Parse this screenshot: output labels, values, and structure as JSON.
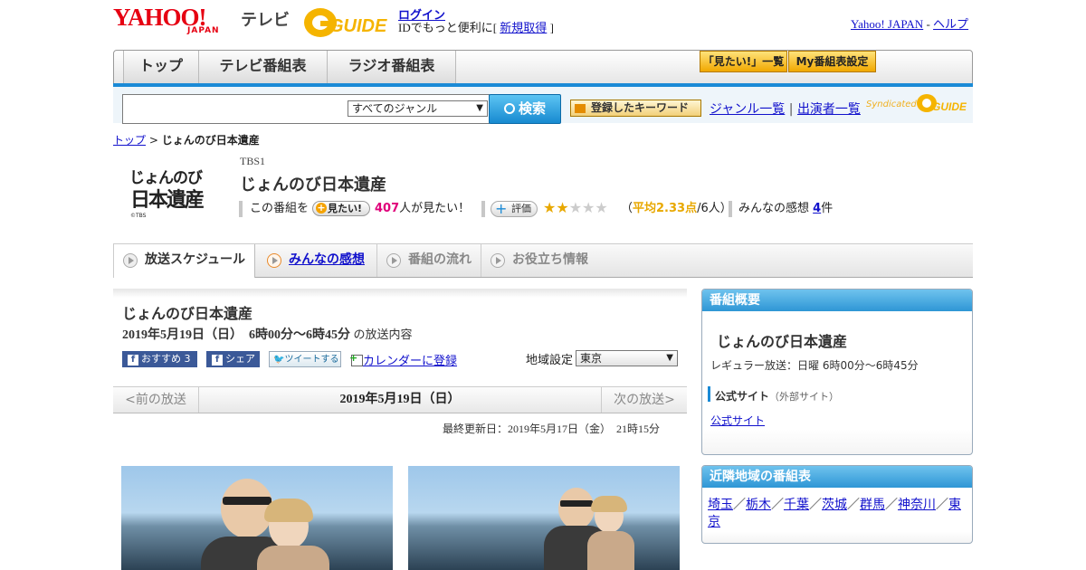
{
  "header": {
    "logo_text": "YAHOO!",
    "logo_sub": "JAPAN",
    "service": "テレビ",
    "gguide_text": "GUIDE",
    "login": "ログイン",
    "id_prefix": "IDでもっと便利に[",
    "signup": "新規取得",
    "id_suffix": "]",
    "yahoo_japan": "Yahoo! JAPAN",
    "sep": "-",
    "help": "ヘルプ"
  },
  "nav": {
    "tabs": [
      "トップ",
      "テレビ番組表",
      "ラジオ番組表"
    ],
    "mitai_list": "「見たい!」一覧",
    "my_settings": "My番組表設定"
  },
  "search": {
    "genre_selected": "すべてのジャンル",
    "button": "検索",
    "keyword_button": "登録したキーワード",
    "genre_list": "ジャンル一覧",
    "divider": "|",
    "performers": "出演者一覧",
    "syndicated": "Syndicated"
  },
  "breadcrumb": {
    "top": "トップ",
    "sep": ">",
    "current": "じょんのび日本遺産"
  },
  "program": {
    "logo_line1": "じょんのび",
    "logo_line2": "日本遺産",
    "logo_small": "©TBS",
    "channel": "TBS1",
    "title": "じょんのび日本遺産",
    "mitai_prefix": "この番組を",
    "mitai_button": "見たい!",
    "mitai_count": "407",
    "mitai_suffix": "人が見たい！",
    "rate_button": "評価",
    "stars": "★★★★★",
    "rating_filled": 2,
    "avg_open": "（",
    "avg_label": "平均2.33点",
    "avg_count": "/6人）",
    "impressions_label": "みんなの感想",
    "impressions_count": "4",
    "impressions_unit": "件"
  },
  "tabs2": [
    "放送スケジュール",
    "みんなの感想",
    "番組の流れ",
    "お役立ち情報"
  ],
  "panel": {
    "title": "じょんのび日本遺産",
    "date_time": "2019年5月19日（日）　6時00分～6時45分",
    "date_suffix": "の放送内容",
    "recommend": "おすすめ",
    "recommend_count": "3",
    "share": "シェア",
    "tweet": "ツイートする",
    "calendar": "カレンダーに登録",
    "region_label": "地域設定",
    "region_value": "東京",
    "prev": "<前の放送",
    "current_date": "2019年5月19日（日）",
    "next": "次の放送>",
    "last_updated": "最終更新日：2019年5月17日（金）　21時15分"
  },
  "sidebar": {
    "overview_head": "番組概要",
    "overview_title": "じょんのび日本遺産",
    "regular": "レギュラー放送：日曜 6時00分～6時45分",
    "official_label": "公式サイト",
    "official_note": "（外部サイト）",
    "official_link": "公式サイト",
    "nearby_head": "近隣地域の番組表",
    "regions": [
      "埼玉",
      "栃木",
      "千葉",
      "茨城",
      "群馬",
      "神奈川",
      "東京"
    ],
    "region_sep": "／"
  },
  "colors": {
    "accent": "#1a8ad6",
    "brand_red": "#e60012",
    "star": "#e8a800",
    "mitai_pink": "#e0007a"
  }
}
